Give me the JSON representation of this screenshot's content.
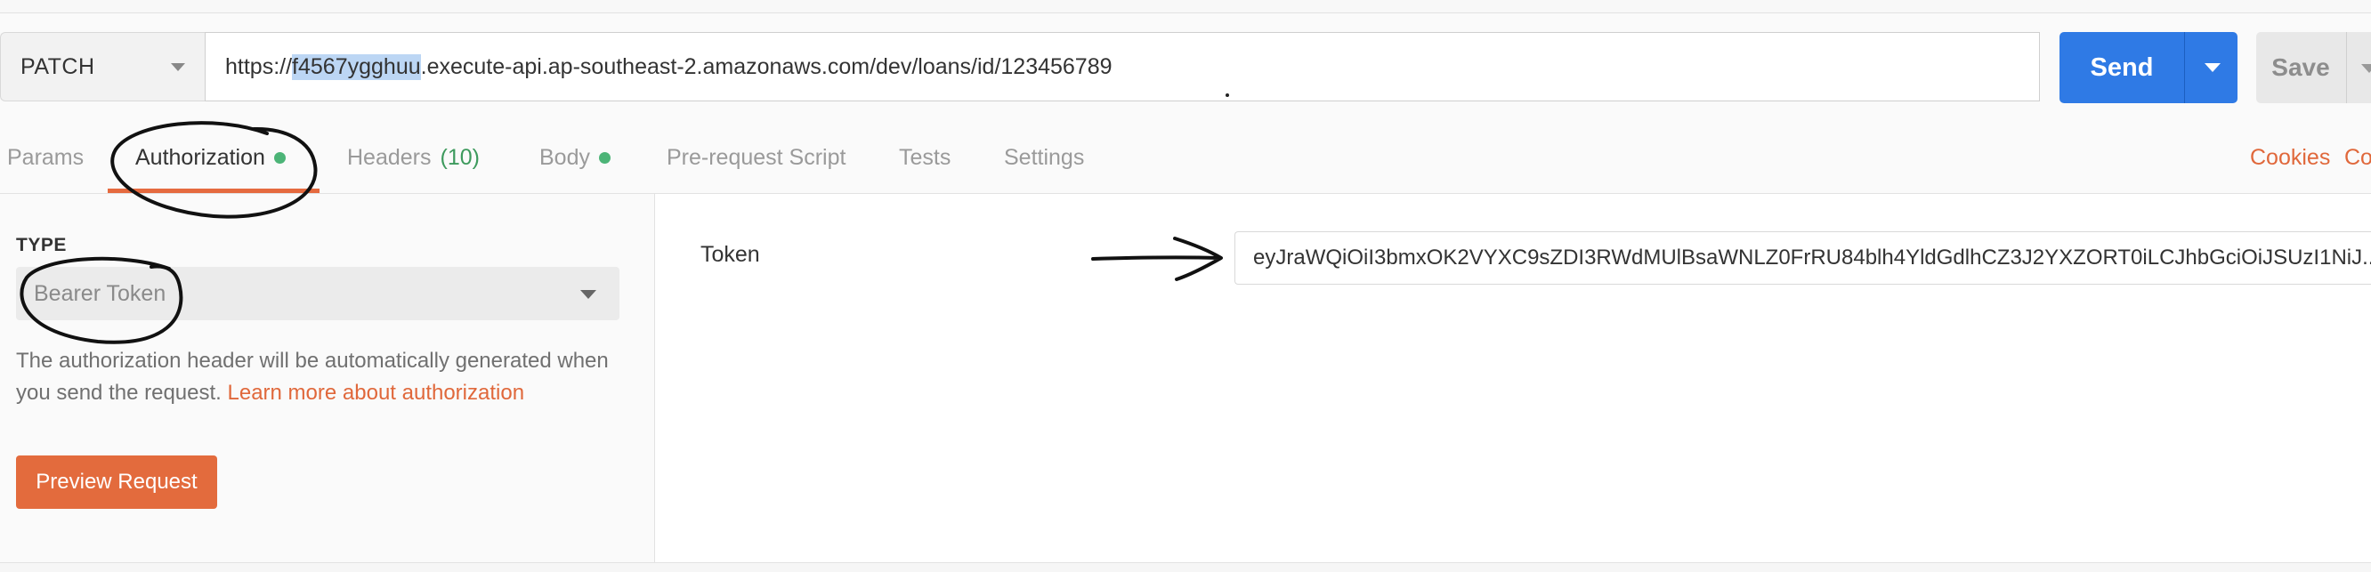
{
  "request": {
    "method": "PATCH",
    "url_prefix": "https://",
    "url_highlight": "f4567ygghuu",
    "url_rest": ".execute-api.ap-southeast-2.amazonaws.com/dev/loans/id/123456789",
    "send_label": "Send",
    "save_label": "Save"
  },
  "tabs": {
    "params": "Params",
    "authorization": "Authorization",
    "headers": "Headers",
    "headers_count": "(10)",
    "body": "Body",
    "prerequest": "Pre-request Script",
    "tests": "Tests",
    "settings": "Settings",
    "cookies": "Cookies",
    "code": "Co"
  },
  "auth": {
    "type_label": "TYPE",
    "type_value": "Bearer Token",
    "description": "The authorization header will be automatically generated when you send the request. ",
    "learn_more": "Learn more about authorization",
    "preview_button": "Preview Request",
    "token_label": "Token",
    "token_value": "eyJraWQiOiI3bmxOK2VYXC9sZDI3RWdMUlBsaWNLZ0FrRU84blh4YldGdlhCZ3J2YXZORT0iLCJhbGciOiJSUzI1NiJ..."
  },
  "colors": {
    "send_blue": "#2f7ae5",
    "accent_orange": "#e56a3f",
    "status_green": "#4cb477"
  }
}
